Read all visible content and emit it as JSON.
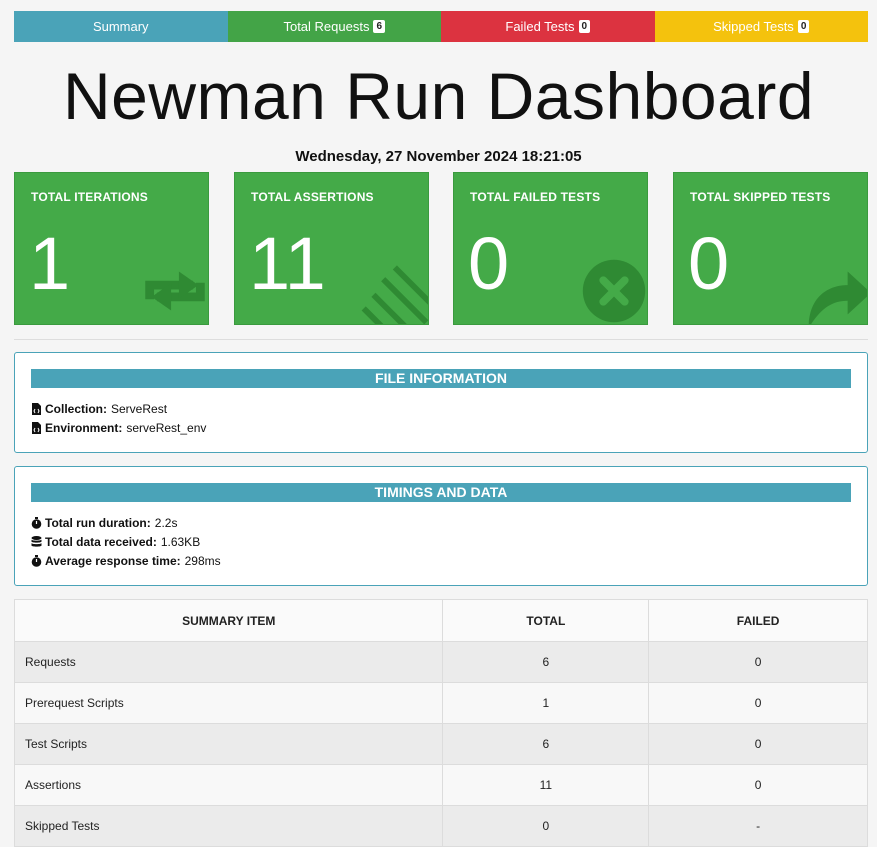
{
  "tabs": [
    {
      "label": "Summary",
      "badge": null
    },
    {
      "label": "Total Requests",
      "badge": "6"
    },
    {
      "label": "Failed Tests",
      "badge": "0"
    },
    {
      "label": "Skipped Tests",
      "badge": "0"
    }
  ],
  "title": "Newman Run Dashboard",
  "datetime": "Wednesday, 27 November 2024 18:21:05",
  "cards": [
    {
      "label": "TOTAL ITERATIONS",
      "value": "1",
      "icon": "sync-icon"
    },
    {
      "label": "TOTAL ASSERTIONS",
      "value": "11",
      "icon": "tasks-icon"
    },
    {
      "label": "TOTAL FAILED TESTS",
      "value": "0",
      "icon": "times-circle-icon"
    },
    {
      "label": "TOTAL SKIPPED TESTS",
      "value": "0",
      "icon": "share-icon"
    }
  ],
  "file_info": {
    "heading": "FILE INFORMATION",
    "collection_label": "Collection:",
    "collection_value": "ServeRest",
    "environment_label": "Environment:",
    "environment_value": "serveRest_env"
  },
  "timings": {
    "heading": "TIMINGS AND DATA",
    "duration_label": "Total run duration:",
    "duration_value": "2.2s",
    "data_label": "Total data received:",
    "data_value": "1.63KB",
    "response_label": "Average response time:",
    "response_value": "298ms"
  },
  "summary_table": {
    "headers": [
      "SUMMARY ITEM",
      "TOTAL",
      "FAILED"
    ],
    "rows": [
      {
        "item": "Requests",
        "total": "6",
        "failed": "0"
      },
      {
        "item": "Prerequest Scripts",
        "total": "1",
        "failed": "0"
      },
      {
        "item": "Test Scripts",
        "total": "6",
        "failed": "0"
      },
      {
        "item": "Assertions",
        "total": "11",
        "failed": "0"
      },
      {
        "item": "Skipped Tests",
        "total": "0",
        "failed": "-"
      }
    ]
  },
  "colors": {
    "summary_tab": "#4aa3b8",
    "requests_tab": "#43a447",
    "failed_tab": "#dc3340",
    "skipped_tab": "#f4c20d",
    "card_green": "#44aa48"
  }
}
